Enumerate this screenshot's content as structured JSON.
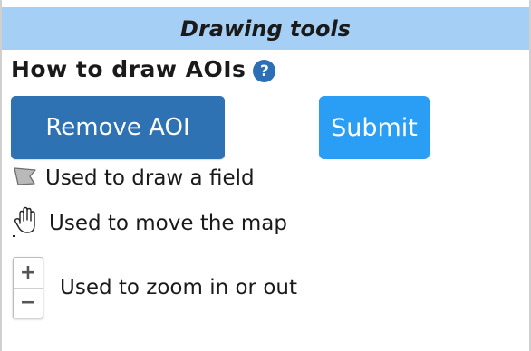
{
  "header": {
    "title": "Drawing tools"
  },
  "howto": {
    "title": "How to draw AOIs",
    "help_icon": "question-circle-icon"
  },
  "buttons": {
    "remove_label": "Remove AOI",
    "submit_label": "Submit",
    "remove_color": "#2f72b3",
    "submit_color": "#2a9df4"
  },
  "tools": [
    {
      "icon": "polygon-draw-icon",
      "label": "Used to draw a field"
    },
    {
      "icon": "hand-pan-icon",
      "label": "Used to move the map"
    },
    {
      "icon": "zoom-control-icon",
      "label": "Used to zoom in or out"
    }
  ],
  "zoom": {
    "in_label": "+",
    "out_label": "−"
  },
  "colors": {
    "header_bg": "#a6cff5",
    "help_icon": "#2c6fb5"
  }
}
